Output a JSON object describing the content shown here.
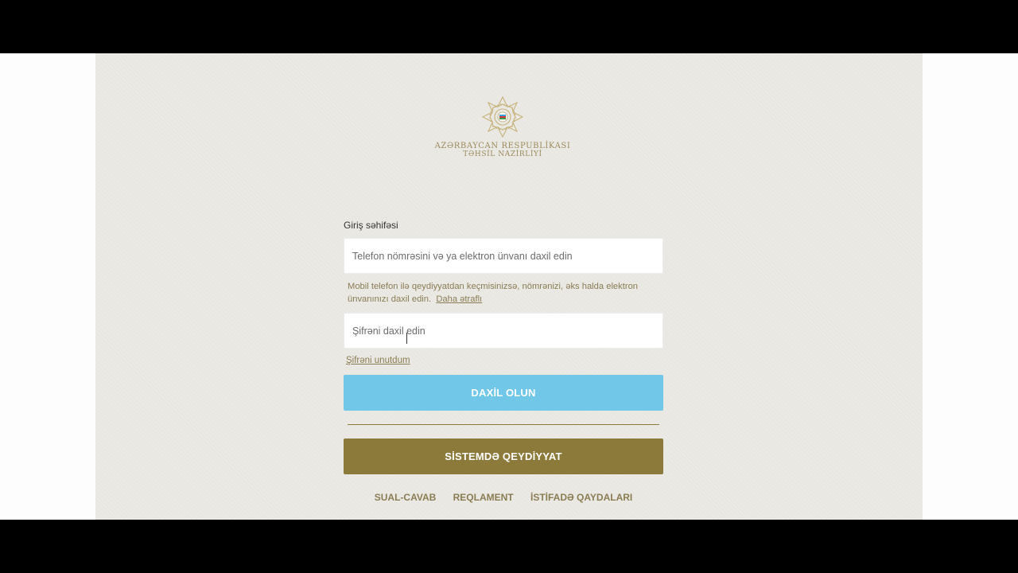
{
  "header": {
    "org_line1": "AZƏRBAYCAN RESPUBLİKASI",
    "org_line2": "TƏHSİL NAZİRLİYİ"
  },
  "login": {
    "title": "Giriş səhifəsi",
    "phone_placeholder": "Telefon nömrəsini və ya elektron ünvanı daxil edin",
    "hint_text": "Mobil telefon ilə qeydiyyatdan keçmisinizsə, nömrənizi, əks halda elektron ünvanınızı daxil edin.",
    "hint_link": "Daha ətraflı",
    "password_placeholder": "Şifrəni daxil edin",
    "forgot_label": "Şifrəni unutdum",
    "login_button": "DAXİL OLUN",
    "register_button": "SİSTEMDƏ QEYDİYYAT"
  },
  "footer": {
    "links": [
      "SUAL-CAVAB",
      "REQLAMENT",
      "İSTİFADƏ QAYDALARI"
    ]
  },
  "colors": {
    "accent_gold": "#8c7a3b",
    "login_blue": "#71c7e8",
    "background": "#e9e7e2"
  },
  "icons": {
    "emblem": "ministry-emblem-icon"
  }
}
